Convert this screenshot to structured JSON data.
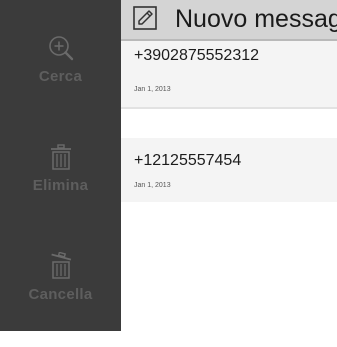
{
  "sidebar": {
    "search": {
      "label": "Cerca",
      "icon": "zoom-in-icon"
    },
    "delete": {
      "label": "Elimina",
      "icon": "trash-icon"
    },
    "clear": {
      "label": "Cancella",
      "icon": "trash-open-icon"
    }
  },
  "header": {
    "title": "Nuovo messaggio",
    "icon": "compose-icon"
  },
  "conversations": [
    {
      "number": "+3902875552312",
      "date": "Jan 1, 2013"
    },
    {
      "number": "+12125557454",
      "date": "Jan 1, 2013"
    }
  ],
  "colors": {
    "sidebar_bg": "#3b3b3b",
    "sidebar_label": "#5e5e5e",
    "header_bg": "#d4d4d4",
    "row_bg": "#f4f4f4"
  }
}
